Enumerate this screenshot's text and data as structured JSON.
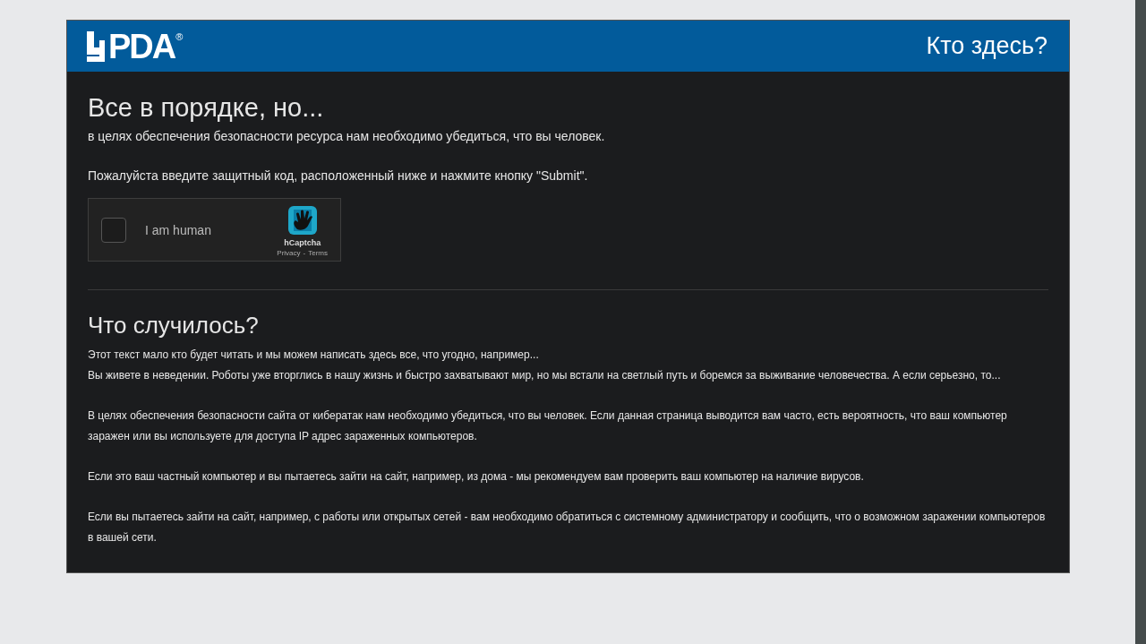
{
  "header": {
    "logo_text": "PDA",
    "logo_mark": "®",
    "title": "Кто здесь?"
  },
  "notice": {
    "heading": "Все в порядке, но...",
    "lines": [
      "в целях обеспечения безопасности ресурса нам необходимо убедиться, что вы человек.",
      "Пожалуйста введите защитный код, расположенный ниже и нажмите кнопку \"Submit\"."
    ]
  },
  "captcha": {
    "label": "I am human",
    "checked": false,
    "brand": "hCaptcha",
    "privacy": "Privacy",
    "separator": "-",
    "terms": "Terms"
  },
  "explanation": {
    "heading": "Что случилось?",
    "paragraphs": [
      [
        "Этот текст мало кто будет читать и мы можем написать здесь все, что угодно, например...",
        "Вы живете в неведении. Роботы уже вторглись в нашу жизнь и быстро захватывают мир, но мы встали на светлый путь и боремся за выживание человечества. А если серьезно, то..."
      ],
      [
        "В целях обеспечения безопасности сайта от кибератак нам необходимо убедиться, что вы человек. Если данная страница выводится вам часто, есть вероятность, что ваш компьютер заражен или вы используете для доступа IP адрес зараженных компьютеров."
      ],
      [
        "Если это ваш частный компьютер и вы пытаетесь зайти на сайт, например, из дома - мы рекомендуем вам проверить ваш компьютер на наличие вирусов."
      ],
      [
        "Если вы пытаетесь зайти на сайт, например, с работы или открытых сетей - вам необходимо обратиться с системному администратору и сообщить, что о возможном заражении компьютеров в вашей сети."
      ]
    ]
  }
}
